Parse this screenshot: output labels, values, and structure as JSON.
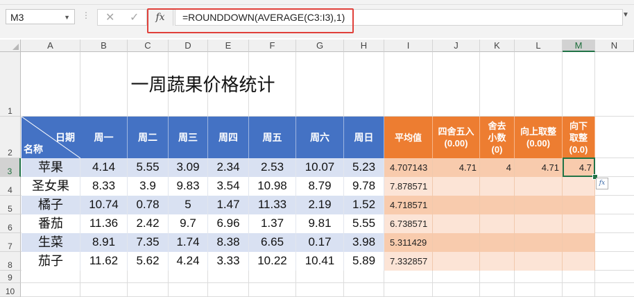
{
  "formula_bar": {
    "name_box": "M3",
    "cancel_icon": "✕",
    "enter_icon": "✓",
    "fx_label": "fx",
    "formula": "=ROUNDDOWN(AVERAGE(C3:I3),1)"
  },
  "columns": [
    "A",
    "B",
    "C",
    "D",
    "E",
    "F",
    "G",
    "H",
    "I",
    "J",
    "K",
    "L",
    "M",
    "N"
  ],
  "rows": [
    "1",
    "2",
    "3",
    "4",
    "5",
    "6",
    "7",
    "8",
    "9",
    "10"
  ],
  "selected_cell": {
    "column": "M",
    "row": "3"
  },
  "sheet": {
    "title": "一周蔬果价格统计",
    "corner_top": "日期",
    "corner_bottom": "名称",
    "day_headers": [
      "周一",
      "周二",
      "周三",
      "周四",
      "周五",
      "周六",
      "周日"
    ],
    "calc_headers": [
      {
        "line1": "平均值",
        "line2": "",
        "line3": ""
      },
      {
        "line1": "四舍五入",
        "line2": "(0.00)",
        "line3": ""
      },
      {
        "line1": "舍去",
        "line2": "小数",
        "line3": "(0)"
      },
      {
        "line1": "向上取整",
        "line2": "(0.00)",
        "line3": ""
      },
      {
        "line1": "向下",
        "line2": "取整",
        "line3": "(0.0)"
      }
    ],
    "items": [
      {
        "name": "苹果",
        "prices": [
          "4.14",
          "5.55",
          "3.09",
          "2.34",
          "2.53",
          "10.07",
          "5.23"
        ],
        "avg": "4.707143",
        "round": "4.71",
        "trunc": "4",
        "roundup": "4.71",
        "rounddown": "4.7"
      },
      {
        "name": "圣女果",
        "prices": [
          "8.33",
          "3.9",
          "9.83",
          "3.54",
          "10.98",
          "8.79",
          "9.78"
        ],
        "avg": "7.878571",
        "round": "",
        "trunc": "",
        "roundup": "",
        "rounddown": ""
      },
      {
        "name": "橘子",
        "prices": [
          "10.74",
          "0.78",
          "5",
          "1.47",
          "11.33",
          "2.19",
          "1.52"
        ],
        "avg": "4.718571",
        "round": "",
        "trunc": "",
        "roundup": "",
        "rounddown": ""
      },
      {
        "name": "番茄",
        "prices": [
          "11.36",
          "2.42",
          "9.7",
          "6.96",
          "1.37",
          "9.81",
          "5.55"
        ],
        "avg": "6.738571",
        "round": "",
        "trunc": "",
        "roundup": "",
        "rounddown": ""
      },
      {
        "name": "生菜",
        "prices": [
          "8.91",
          "7.35",
          "1.74",
          "8.38",
          "6.65",
          "0.17",
          "3.98"
        ],
        "avg": "5.311429",
        "round": "",
        "trunc": "",
        "roundup": "",
        "rounddown": ""
      },
      {
        "name": "茄子",
        "prices": [
          "11.62",
          "5.62",
          "4.24",
          "3.33",
          "10.22",
          "10.41",
          "5.89"
        ],
        "avg": "7.332857",
        "round": "",
        "trunc": "",
        "roundup": "",
        "rounddown": ""
      }
    ]
  },
  "colors": {
    "header_blue": "#4472c4",
    "header_orange": "#ed7d31",
    "band_blue": "#d9e1f2",
    "band_orange_dark": "#f8cbad",
    "band_orange_light": "#fce4d6",
    "selection_green": "#217346",
    "highlight_red": "#e0403a"
  }
}
